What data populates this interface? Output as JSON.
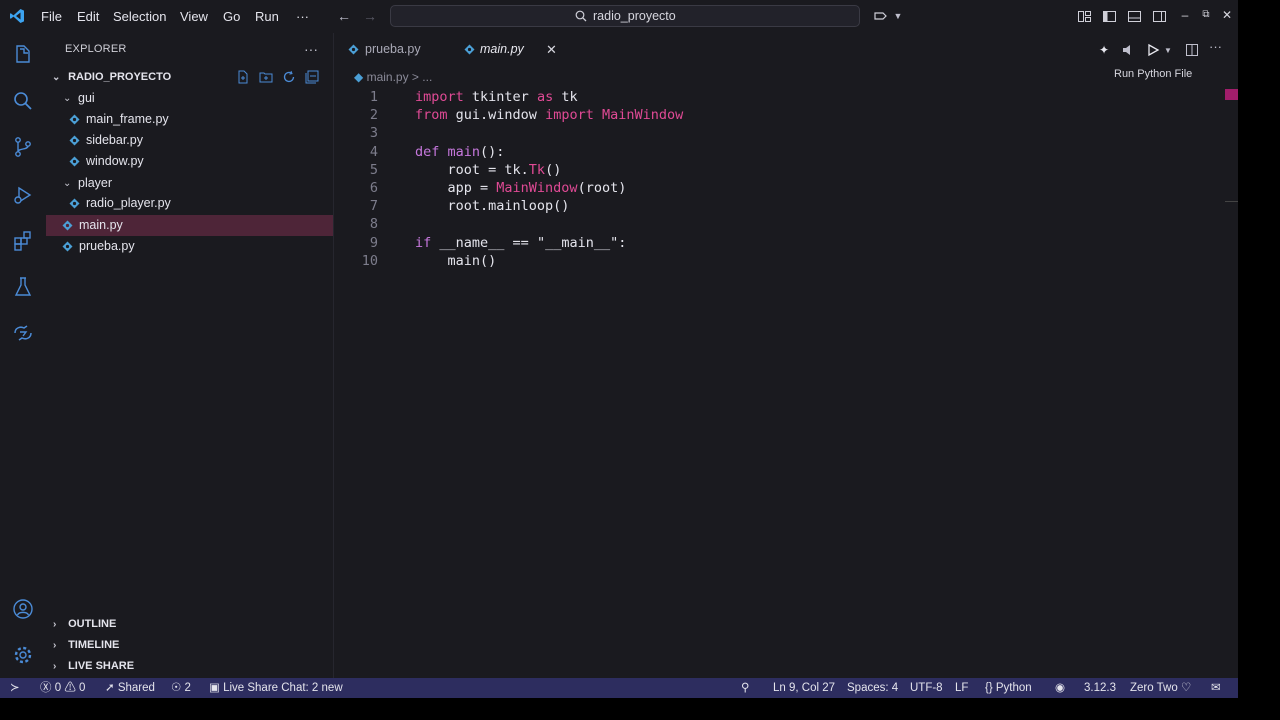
{
  "menu": [
    "File",
    "Edit",
    "Selection",
    "View",
    "Go",
    "Run",
    "···"
  ],
  "search": {
    "text": "radio_proyecto"
  },
  "tooltip": "Run Python File",
  "explorer": {
    "title": "EXPLORER",
    "project": "RADIO_PROYECTO",
    "tree": [
      {
        "label": "gui",
        "type": "folder"
      },
      {
        "label": "main_frame.py",
        "type": "file"
      },
      {
        "label": "sidebar.py",
        "type": "file"
      },
      {
        "label": "window.py",
        "type": "file"
      },
      {
        "label": "player",
        "type": "folder"
      },
      {
        "label": "radio_player.py",
        "type": "file"
      },
      {
        "label": "main.py",
        "type": "file",
        "selected": true
      },
      {
        "label": "prueba.py",
        "type": "file"
      }
    ],
    "sections": [
      "OUTLINE",
      "TIMELINE",
      "LIVE SHARE"
    ]
  },
  "tabs": [
    {
      "label": "prueba.py",
      "active": false
    },
    {
      "label": "main.py",
      "active": true
    }
  ],
  "breadcrumb": "main.py > ...",
  "code": [
    {
      "n": "1",
      "tokens": [
        [
          "kw2",
          "import"
        ],
        [
          "plain",
          " tkinter "
        ],
        [
          "kw2",
          "as"
        ],
        [
          "plain",
          " tk"
        ]
      ]
    },
    {
      "n": "2",
      "tokens": [
        [
          "kw2",
          "from"
        ],
        [
          "plain",
          " gui.window "
        ],
        [
          "kw2",
          "import"
        ],
        [
          "plain",
          " "
        ],
        [
          "cls",
          "MainWindow"
        ]
      ]
    },
    {
      "n": "3",
      "tokens": []
    },
    {
      "n": "4",
      "tokens": [
        [
          "kw",
          "def"
        ],
        [
          "plain",
          " "
        ],
        [
          "fn",
          "main"
        ],
        [
          "plain",
          "():"
        ]
      ]
    },
    {
      "n": "5",
      "tokens": [
        [
          "plain",
          "    root = tk."
        ],
        [
          "cls",
          "Tk"
        ],
        [
          "plain",
          "()"
        ]
      ]
    },
    {
      "n": "6",
      "tokens": [
        [
          "plain",
          "    app = "
        ],
        [
          "cls",
          "MainWindow"
        ],
        [
          "plain",
          "(root)"
        ]
      ]
    },
    {
      "n": "7",
      "tokens": [
        [
          "plain",
          "    root.mainloop()"
        ]
      ]
    },
    {
      "n": "8",
      "tokens": []
    },
    {
      "n": "9",
      "tokens": [
        [
          "kw",
          "if"
        ],
        [
          "plain",
          " __name__ == "
        ],
        [
          "str",
          "\"__main__\""
        ],
        [
          "plain",
          ":"
        ]
      ]
    },
    {
      "n": "10",
      "tokens": [
        [
          "plain",
          "    main()"
        ]
      ]
    }
  ],
  "status": {
    "errors": "0",
    "warnings": "0",
    "shared": "Shared",
    "participants": "2",
    "chat": "Live Share Chat: 2 new",
    "position": "Ln 9, Col 27",
    "spaces": "Spaces: 4",
    "encoding": "UTF-8",
    "eol": "LF",
    "language": "Python",
    "python_version": "3.12.3",
    "theme": "Zero Two"
  },
  "colors": {
    "accent": "#2d2d5f",
    "selection": "#4e2538",
    "keyword": "#c678dd",
    "class": "#e04a95"
  }
}
